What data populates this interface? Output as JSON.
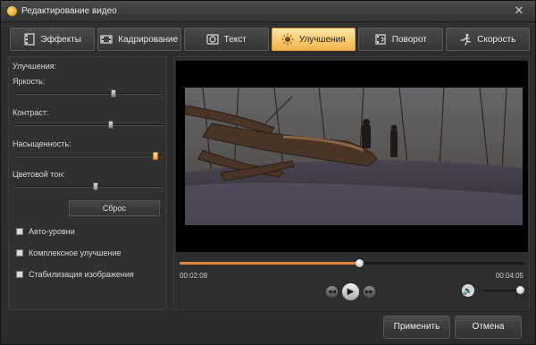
{
  "window": {
    "title": "Редактирование видео",
    "close_glyph": "✕"
  },
  "tabs": [
    {
      "label": "Эффекты",
      "icon": "film-effects-icon"
    },
    {
      "label": "Кадрирование",
      "icon": "crop-film-icon"
    },
    {
      "label": "Текст",
      "icon": "text-frame-icon"
    },
    {
      "label": "Улучшения",
      "icon": "enhance-sun-icon",
      "active": true
    },
    {
      "label": "Поворот",
      "icon": "rotate-film-icon"
    },
    {
      "label": "Скорость",
      "icon": "running-man-icon"
    }
  ],
  "enhance": {
    "section_title": "Улучшения:",
    "brightness": {
      "label": "Яркость:",
      "value": 0.67
    },
    "contrast": {
      "label": "Контраст:",
      "value": 0.65
    },
    "saturation": {
      "label": "Насыщенность:",
      "value": 0.95
    },
    "hue": {
      "label": "Цветовой тон:",
      "value": 0.55
    },
    "reset_label": "Сброс",
    "checkboxes": [
      {
        "label": "Авто-уровни",
        "checked": false
      },
      {
        "label": "Комплексное улучшение",
        "checked": false
      },
      {
        "label": "Стабилизация изображения",
        "checked": false
      }
    ]
  },
  "player": {
    "current_time": "00:02:08",
    "total_time": "00:04:05",
    "progress": 0.52,
    "volume": 0.9,
    "prev_glyph": "◀◀",
    "play_glyph": "▶",
    "next_glyph": "▶▶",
    "volume_glyph": "🔊"
  },
  "buttons": {
    "apply": "Применить",
    "cancel": "Отмена"
  },
  "colors": {
    "accent": "#f2b24a",
    "seek": "#e0833c"
  }
}
